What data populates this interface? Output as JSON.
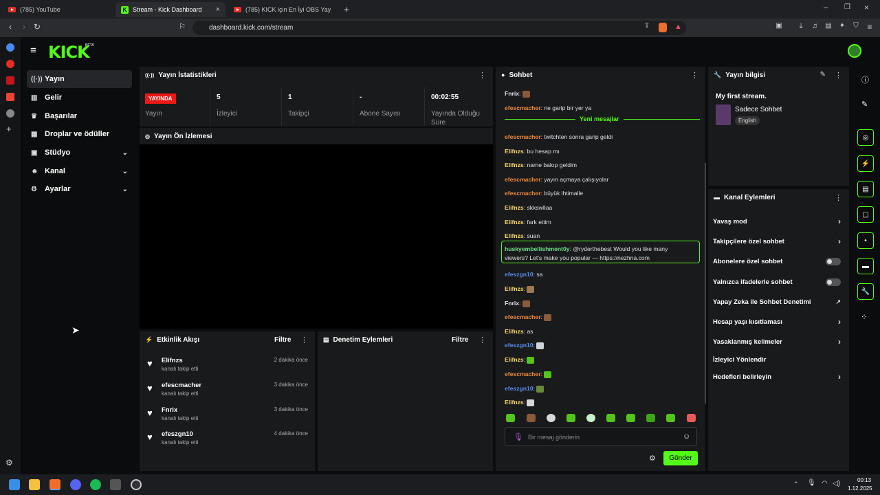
{
  "browser": {
    "tabs": [
      {
        "label": "(785) YouTube"
      },
      {
        "label": "Stream - Kick Dashboard"
      },
      {
        "label": "(785) KICK için En İyi OBS Yayın Ayarı"
      }
    ],
    "url": "dashboard.kick.com/stream"
  },
  "app": {
    "logo": "KICK",
    "beta": "BETA"
  },
  "sidebar": {
    "items": [
      {
        "label": "Yayın",
        "icon": "broadcast-icon"
      },
      {
        "label": "Gelir",
        "icon": "chart-icon"
      },
      {
        "label": "Başarılar",
        "icon": "trophy-icon"
      },
      {
        "label": "Droplar ve ödüller",
        "icon": "gift-icon"
      },
      {
        "label": "Stüdyo",
        "icon": "studio-icon"
      },
      {
        "label": "Kanal",
        "icon": "people-icon"
      },
      {
        "label": "Ayarlar",
        "icon": "gear-icon"
      }
    ]
  },
  "stats": {
    "title": "Yayın İstatistikleri",
    "live_badge": "YAYINDA",
    "items": [
      {
        "value": "",
        "label": "Yayın"
      },
      {
        "value": "5",
        "label": "İzleyici"
      },
      {
        "value": "1",
        "label": "Takipçi"
      },
      {
        "value": "-",
        "label": "Abone Sayısı"
      },
      {
        "value": "00:02:55",
        "label": "Yayında Olduğu Süre"
      }
    ]
  },
  "preview": {
    "title": "Yayın Ön İzlemesi"
  },
  "activity": {
    "title": "Etkinlik Akışı",
    "filter": "Filtre",
    "items": [
      {
        "name": "Elifnzs",
        "sub": "kanalı takip etti",
        "time": "2 dakika önce"
      },
      {
        "name": "efescmacher",
        "sub": "kanalı takip etti",
        "time": "3 dakika önce"
      },
      {
        "name": "Fnrix",
        "sub": "kanalı takip etti",
        "time": "3 dakika önce"
      },
      {
        "name": "efeszgn10",
        "sub": "kanalı takip etti",
        "time": "4 dakika önce"
      }
    ]
  },
  "moderation": {
    "title": "Denetim Eylemleri",
    "filter": "Filtre"
  },
  "chat": {
    "title": "Sohbet",
    "new_messages": "Yeni mesajlar",
    "messages": [
      {
        "user": "Fnrix",
        "text": "",
        "color": "#e8e8e8",
        "emote": "#8a5a3a"
      },
      {
        "user": "efescmacher",
        "text": "ne garip bir yer ya",
        "color": "#f08a3c"
      },
      {
        "user": "efescmacher",
        "text": "twitchten sonra garip geldi",
        "color": "#f08a3c"
      },
      {
        "user": "Elifnzs",
        "text": "bu hesap mı",
        "color": "#f5d76e"
      },
      {
        "user": "Elifnzs",
        "text": "name bakıp geldim",
        "color": "#f5d76e"
      },
      {
        "user": "efescmacher",
        "text": "yayın açmaya çalışıyolar",
        "color": "#f08a3c"
      },
      {
        "user": "efescmacher",
        "text": "büyük ihtimalle",
        "color": "#f08a3c"
      },
      {
        "user": "Elifnzs",
        "text": "skkswllaa",
        "color": "#f5d76e"
      },
      {
        "user": "Elifnzs",
        "text": "fark ettim",
        "color": "#f5d76e"
      },
      {
        "user": "Elifnzs",
        "text": "suan",
        "color": "#f5d76e"
      },
      {
        "user": "huskyembellishment0y",
        "text": "@ryderthebest Would you like many",
        "text2": "viewers? Let's make you popular — https://nezhna.com",
        "color": "#6fe08a"
      },
      {
        "user": "efeszgn10",
        "text": "sa",
        "color": "#5b8cf0"
      },
      {
        "user": "Elifnzs",
        "text": "",
        "color": "#f5d76e",
        "emote": "#a07850"
      },
      {
        "user": "Fnrix",
        "text": "",
        "color": "#e8e8e8",
        "emote": "#8a5a3a"
      },
      {
        "user": "efescmacher",
        "text": "",
        "color": "#f08a3c",
        "emote": "#8a5a3a"
      },
      {
        "user": "Elifnzs",
        "text": "as",
        "color": "#f5d76e"
      },
      {
        "user": "efeszgn10",
        "text": "",
        "color": "#5b8cf0",
        "emote": "#cfd4d8"
      },
      {
        "user": "Elifnzs",
        "text": "",
        "color": "#f5d76e",
        "emote": "#53c41b"
      },
      {
        "user": "efescmacher",
        "text": "",
        "color": "#f08a3c",
        "emote": "#53c41b"
      },
      {
        "user": "efeszgn10",
        "text": "",
        "color": "#5b8cf0",
        "emote": "#6a8a3a"
      },
      {
        "user": "Elifnzs",
        "text": "",
        "color": "#f5d76e",
        "emote": "#d8d8d8"
      }
    ],
    "placeholder": "Bir mesaj gönderin",
    "send": "Gönder"
  },
  "stream_info": {
    "title": "Yayın bilgisi",
    "stream_title": "My first stream.",
    "category": "Sadece Sohbet",
    "language": "English"
  },
  "channel_actions": {
    "title": "Kanal Eylemleri",
    "items": [
      {
        "label": "Yavaş mod",
        "kind": "chevron"
      },
      {
        "label": "Takipçilere özel sohbet",
        "kind": "chevron"
      },
      {
        "label": "Abonelere özel sohbet",
        "kind": "toggle"
      },
      {
        "label": "Yalnızca ifadelerle sohbet",
        "kind": "toggle"
      },
      {
        "label": "Yapay Zeka ile Sohbet Denetimi",
        "kind": "icon"
      },
      {
        "label": "Hesap yaşı kısıtlaması",
        "kind": "chevron"
      },
      {
        "label": "Yasaklanmış kelimeler",
        "kind": "chevron"
      },
      {
        "label": "İzleyici Yönlendir",
        "kind": "none"
      },
      {
        "label": "Hedefleri belirleyin",
        "kind": "chevron"
      }
    ]
  },
  "taskbar": {
    "time": "00:13",
    "date": "1.12.2025"
  },
  "colors": {
    "accent": "#53fc18",
    "live": "#e91916",
    "panel": "#191a1c",
    "bg": "#0b0c0d"
  }
}
